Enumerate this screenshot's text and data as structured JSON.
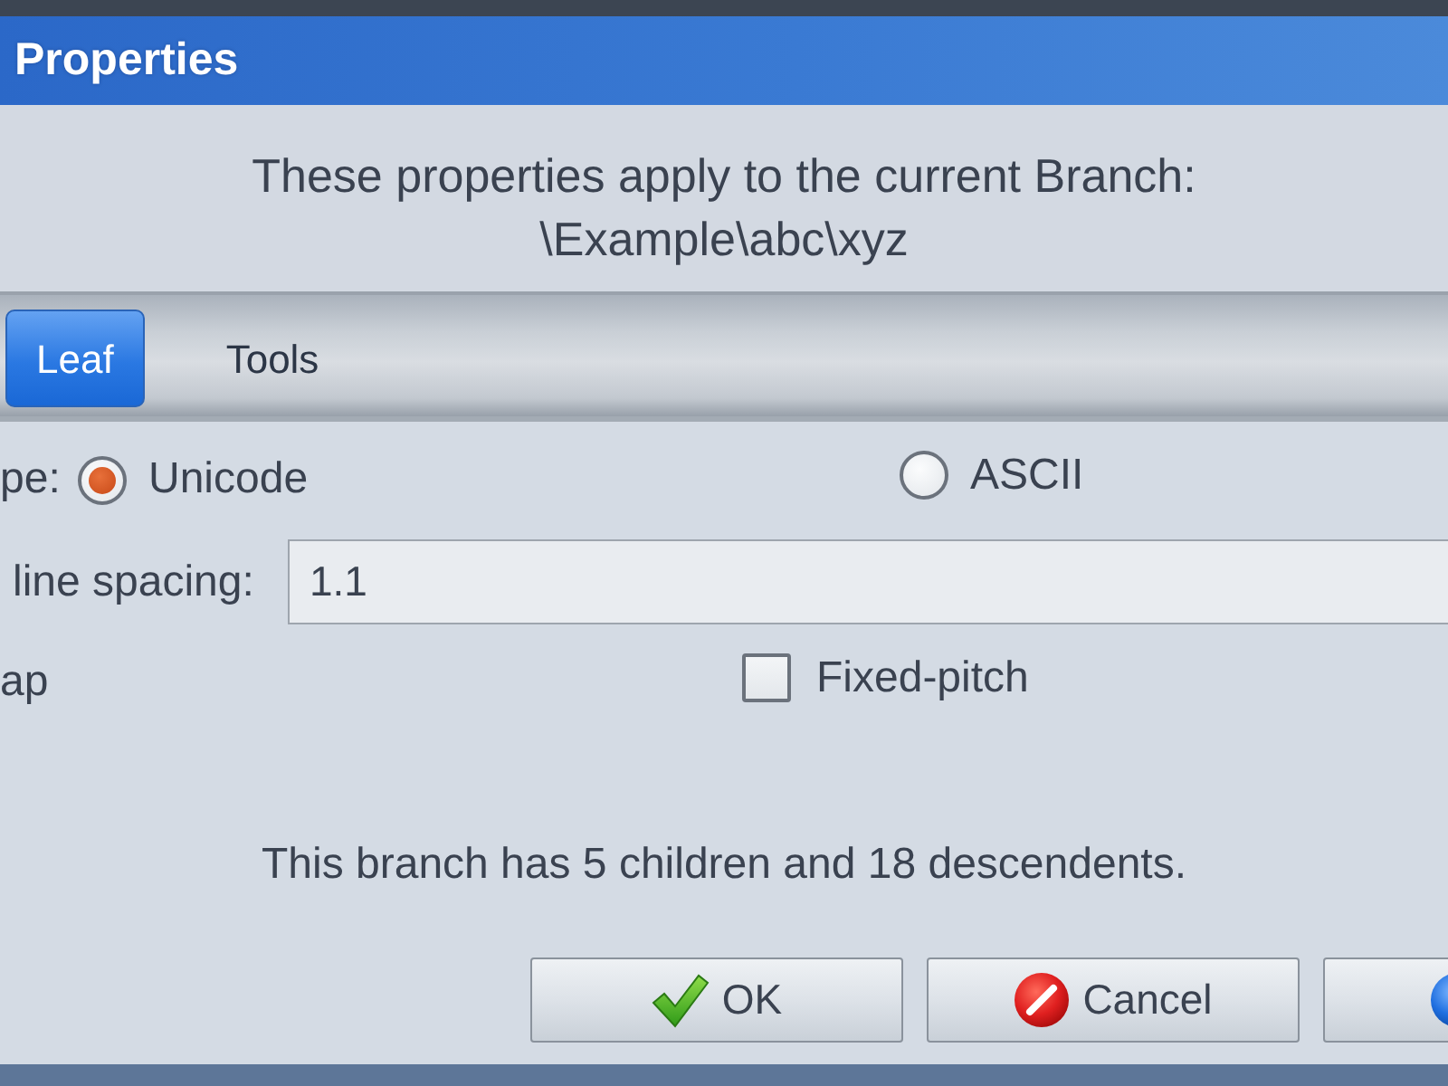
{
  "window": {
    "title": "Properties"
  },
  "header": {
    "message": "These properties apply to the current Branch:",
    "path": "\\Example\\abc\\xyz"
  },
  "tabs": [
    {
      "label": "Leaf",
      "selected": true
    },
    {
      "label": "Tools",
      "selected": false
    }
  ],
  "form": {
    "encoding": {
      "label": "pe:",
      "options": [
        {
          "label": "Unicode",
          "selected": true
        },
        {
          "label": "ASCII",
          "selected": false
        }
      ]
    },
    "line_spacing": {
      "label": "line spacing:",
      "value": "1.1"
    },
    "wrap": {
      "label": "ap"
    },
    "fixed_pitch": {
      "label": "Fixed-pitch",
      "checked": false
    }
  },
  "summary": "This branch has 5 children and 18 descendents.",
  "buttons": [
    {
      "kind": "ok",
      "label": "OK"
    },
    {
      "kind": "cancel",
      "label": "Cancel"
    },
    {
      "kind": "round"
    }
  ]
}
